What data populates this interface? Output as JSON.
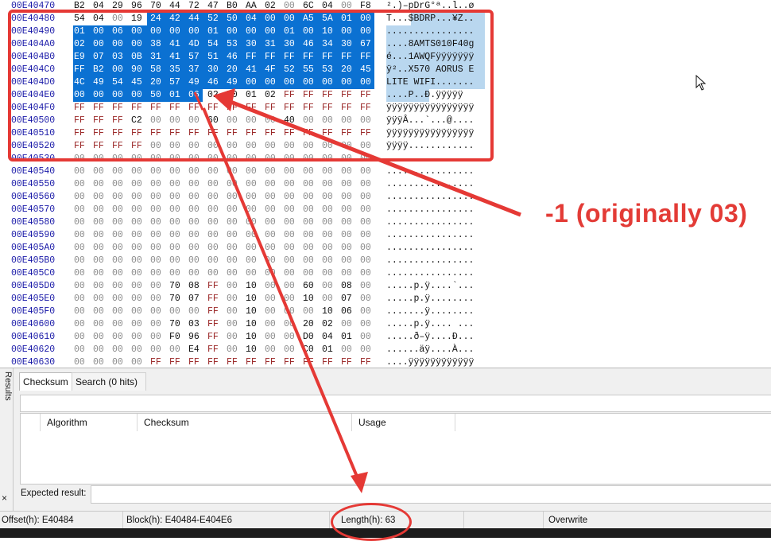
{
  "hex_rows": [
    {
      "offset": "00E40470",
      "bytes": [
        "B2",
        "04",
        "29",
        "96",
        "70",
        "44",
        "72",
        "47",
        "B0",
        "AA",
        "02",
        "00",
        "6C",
        "04",
        "00",
        "F8"
      ],
      "ascii": "².)–pDrG°ª..l..ø"
    },
    {
      "offset": "00E40480",
      "bytes": [
        "54",
        "04",
        "00",
        "19",
        "24",
        "42",
        "44",
        "52",
        "50",
        "04",
        "00",
        "00",
        "A5",
        "5A",
        "01",
        "00"
      ],
      "ascii": "T...$BDRP...¥Z.."
    },
    {
      "offset": "00E40490",
      "bytes": [
        "01",
        "00",
        "06",
        "00",
        "00",
        "00",
        "00",
        "01",
        "00",
        "00",
        "00",
        "01",
        "00",
        "10",
        "00",
        "00"
      ],
      "ascii": "................"
    },
    {
      "offset": "00E404A0",
      "bytes": [
        "02",
        "00",
        "00",
        "00",
        "38",
        "41",
        "4D",
        "54",
        "53",
        "30",
        "31",
        "30",
        "46",
        "34",
        "30",
        "67"
      ],
      "ascii": "....8AMTS010F40g"
    },
    {
      "offset": "00E404B0",
      "bytes": [
        "E9",
        "07",
        "03",
        "0B",
        "31",
        "41",
        "57",
        "51",
        "46",
        "FF",
        "FF",
        "FF",
        "FF",
        "FF",
        "FF",
        "FF"
      ],
      "ascii": "é...1AWQFÿÿÿÿÿÿÿ"
    },
    {
      "offset": "00E404C0",
      "bytes": [
        "FF",
        "B2",
        "00",
        "90",
        "58",
        "35",
        "37",
        "30",
        "20",
        "41",
        "4F",
        "52",
        "55",
        "53",
        "20",
        "45"
      ],
      "ascii": "ÿ²..X570 AORUS E"
    },
    {
      "offset": "00E404D0",
      "bytes": [
        "4C",
        "49",
        "54",
        "45",
        "20",
        "57",
        "49",
        "46",
        "49",
        "00",
        "00",
        "00",
        "00",
        "00",
        "00",
        "00"
      ],
      "ascii": "LITE WIFI......."
    },
    {
      "offset": "00E404E0",
      "bytes": [
        "00",
        "00",
        "00",
        "00",
        "50",
        "01",
        "06",
        "02",
        "D0",
        "01",
        "02",
        "FF",
        "FF",
        "FF",
        "FF",
        "FF"
      ],
      "ascii": "....P..Ð.ÿÿÿÿÿ"
    },
    {
      "offset": "00E404F0",
      "bytes": [
        "FF",
        "FF",
        "FF",
        "FF",
        "FF",
        "FF",
        "FF",
        "FF",
        "FF",
        "FF",
        "FF",
        "FF",
        "FF",
        "FF",
        "FF",
        "FF"
      ],
      "ascii": "ÿÿÿÿÿÿÿÿÿÿÿÿÿÿÿÿ"
    },
    {
      "offset": "00E40500",
      "bytes": [
        "FF",
        "FF",
        "FF",
        "C2",
        "00",
        "00",
        "00",
        "60",
        "00",
        "00",
        "00",
        "40",
        "00",
        "00",
        "00",
        "00"
      ],
      "ascii": "ÿÿÿÂ...`...@...."
    },
    {
      "offset": "00E40510",
      "bytes": [
        "FF",
        "FF",
        "FF",
        "FF",
        "FF",
        "FF",
        "FF",
        "FF",
        "FF",
        "FF",
        "FF",
        "FF",
        "FF",
        "FF",
        "FF",
        "FF"
      ],
      "ascii": "ÿÿÿÿÿÿÿÿÿÿÿÿÿÿÿÿ"
    },
    {
      "offset": "00E40520",
      "bytes": [
        "FF",
        "FF",
        "FF",
        "FF",
        "00",
        "00",
        "00",
        "00",
        "00",
        "00",
        "00",
        "00",
        "00",
        "00",
        "00",
        "00"
      ],
      "ascii": "ÿÿÿÿ............"
    },
    {
      "offset": "00E40530",
      "bytes": [
        "00",
        "00",
        "00",
        "00",
        "00",
        "00",
        "00",
        "00",
        "00",
        "00",
        "00",
        "00",
        "00",
        "00",
        "00",
        "00"
      ],
      "ascii": "................"
    },
    {
      "offset": "00E40540",
      "bytes": [
        "00",
        "00",
        "00",
        "00",
        "00",
        "00",
        "00",
        "00",
        "00",
        "00",
        "00",
        "00",
        "00",
        "00",
        "00",
        "00"
      ],
      "ascii": "................"
    },
    {
      "offset": "00E40550",
      "bytes": [
        "00",
        "00",
        "00",
        "00",
        "00",
        "00",
        "00",
        "00",
        "00",
        "00",
        "00",
        "00",
        "00",
        "00",
        "00",
        "00"
      ],
      "ascii": "................"
    },
    {
      "offset": "00E40560",
      "bytes": [
        "00",
        "00",
        "00",
        "00",
        "00",
        "00",
        "00",
        "00",
        "00",
        "00",
        "00",
        "00",
        "00",
        "00",
        "00",
        "00"
      ],
      "ascii": "................"
    },
    {
      "offset": "00E40570",
      "bytes": [
        "00",
        "00",
        "00",
        "00",
        "00",
        "00",
        "00",
        "00",
        "00",
        "00",
        "00",
        "00",
        "00",
        "00",
        "00",
        "00"
      ],
      "ascii": "................"
    },
    {
      "offset": "00E40580",
      "bytes": [
        "00",
        "00",
        "00",
        "00",
        "00",
        "00",
        "00",
        "00",
        "00",
        "00",
        "00",
        "00",
        "00",
        "00",
        "00",
        "00"
      ],
      "ascii": "................"
    },
    {
      "offset": "00E40590",
      "bytes": [
        "00",
        "00",
        "00",
        "00",
        "00",
        "00",
        "00",
        "00",
        "00",
        "00",
        "00",
        "00",
        "00",
        "00",
        "00",
        "00"
      ],
      "ascii": "................"
    },
    {
      "offset": "00E405A0",
      "bytes": [
        "00",
        "00",
        "00",
        "00",
        "00",
        "00",
        "00",
        "00",
        "00",
        "00",
        "00",
        "00",
        "00",
        "00",
        "00",
        "00"
      ],
      "ascii": "................"
    },
    {
      "offset": "00E405B0",
      "bytes": [
        "00",
        "00",
        "00",
        "00",
        "00",
        "00",
        "00",
        "00",
        "00",
        "00",
        "00",
        "00",
        "00",
        "00",
        "00",
        "00"
      ],
      "ascii": "................"
    },
    {
      "offset": "00E405C0",
      "bytes": [
        "00",
        "00",
        "00",
        "00",
        "00",
        "00",
        "00",
        "00",
        "00",
        "00",
        "00",
        "00",
        "00",
        "00",
        "00",
        "00"
      ],
      "ascii": "................"
    },
    {
      "offset": "00E405D0",
      "bytes": [
        "00",
        "00",
        "00",
        "00",
        "00",
        "70",
        "08",
        "FF",
        "00",
        "10",
        "00",
        "00",
        "60",
        "00",
        "08",
        "00"
      ],
      "ascii": ".....p.ÿ....`..."
    },
    {
      "offset": "00E405E0",
      "bytes": [
        "00",
        "00",
        "00",
        "00",
        "00",
        "70",
        "07",
        "FF",
        "00",
        "10",
        "00",
        "00",
        "10",
        "00",
        "07",
        "00"
      ],
      "ascii": ".....p.ÿ........"
    },
    {
      "offset": "00E405F0",
      "bytes": [
        "00",
        "00",
        "00",
        "00",
        "00",
        "00",
        "00",
        "FF",
        "00",
        "10",
        "00",
        "00",
        "00",
        "10",
        "06",
        "00"
      ],
      "ascii": ".......ÿ........"
    },
    {
      "offset": "00E40600",
      "bytes": [
        "00",
        "00",
        "00",
        "00",
        "00",
        "70",
        "03",
        "FF",
        "00",
        "10",
        "00",
        "00",
        "20",
        "02",
        "00",
        "00"
      ],
      "ascii": ".....p.ÿ.... ..."
    },
    {
      "offset": "00E40610",
      "bytes": [
        "00",
        "00",
        "00",
        "00",
        "00",
        "F0",
        "96",
        "FF",
        "00",
        "10",
        "00",
        "00",
        "D0",
        "04",
        "01",
        "00"
      ],
      "ascii": ".....ð–ÿ....Ð..."
    },
    {
      "offset": "00E40620",
      "bytes": [
        "00",
        "00",
        "00",
        "00",
        "00",
        "00",
        "E4",
        "FF",
        "00",
        "10",
        "00",
        "00",
        "C0",
        "01",
        "00",
        "00"
      ],
      "ascii": "......äÿ....À..."
    },
    {
      "offset": "00E40630",
      "bytes": [
        "00",
        "00",
        "00",
        "00",
        "FF",
        "FF",
        "FF",
        "FF",
        "FF",
        "FF",
        "FF",
        "FF",
        "FF",
        "FF",
        "FF",
        "FF"
      ],
      "ascii": "....ÿÿÿÿÿÿÿÿÿÿÿÿ"
    }
  ],
  "annotation": {
    "note_text": "-1 (originally 03)"
  },
  "results_panel": {
    "side_label": "Results",
    "close_glyph": "×",
    "tabs": [
      {
        "label": "Checksum"
      },
      {
        "label": "Search (0 hits)"
      }
    ],
    "columns": [
      {
        "label": "Algorithm"
      },
      {
        "label": "Checksum"
      },
      {
        "label": "Usage"
      }
    ],
    "expected_label": "Expected result:"
  },
  "status_bar": {
    "offset": "Offset(h): E40484",
    "block": "Block(h): E40484-E404E6",
    "length": "Length(h): 63",
    "mode": "Overwrite"
  },
  "colors": {
    "selection": "#0b71d2",
    "ascii_selection": "#b9d7ef",
    "callout": "#e53935",
    "offset_text": "#1a1aa8"
  }
}
